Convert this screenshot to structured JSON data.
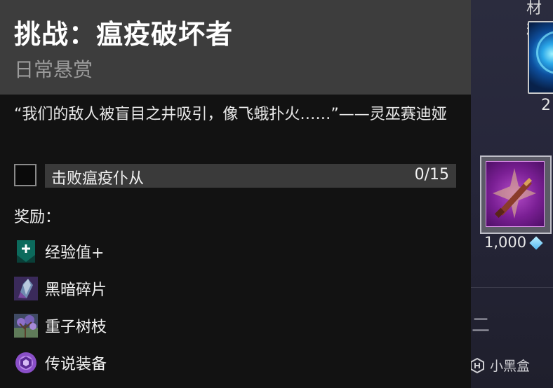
{
  "tooltip": {
    "title": "挑战：瘟疫破坏者",
    "subtitle": "日常悬赏",
    "quote": "“我们的敌人被盲目之井吸引，像飞蛾扑火……”——灵巫赛迪娅",
    "objective": {
      "label": "击败瘟疫仆从",
      "progress": "0/15"
    },
    "rewards_heading": "奖励：",
    "rewards": [
      {
        "label": "经验值+",
        "icon": "xp-plus-icon"
      },
      {
        "label": "黑暗碎片",
        "icon": "dark-fragment-icon"
      },
      {
        "label": "重子树枝",
        "icon": "baryon-bough-icon"
      },
      {
        "label": "传说装备",
        "icon": "legendary-gear-icon"
      }
    ]
  },
  "background": {
    "column_header": "材料",
    "top_card_count": "2",
    "item_price": "1,000",
    "section_label": "二",
    "watermark": "小黑盒"
  },
  "colors": {
    "header_bg": "#3d3d3d",
    "panel_bg": "#121212",
    "objective_bar": "#3a3a3a",
    "legendary_purple": "#7a1f94"
  }
}
